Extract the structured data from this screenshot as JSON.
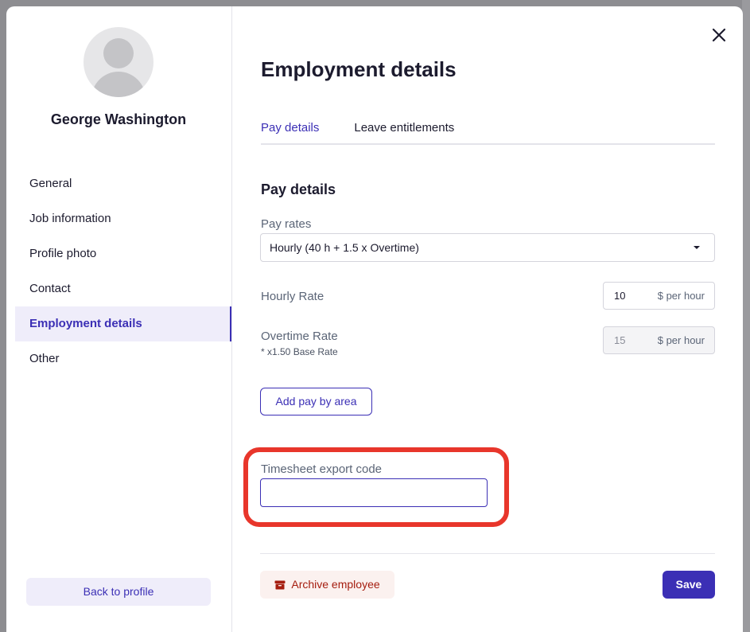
{
  "sidebar": {
    "profile_name": "George Washington",
    "items": [
      {
        "label": "General"
      },
      {
        "label": "Job information"
      },
      {
        "label": "Profile photo"
      },
      {
        "label": "Contact"
      },
      {
        "label": "Employment details",
        "active": true
      },
      {
        "label": "Other"
      }
    ],
    "back_label": "Back to profile"
  },
  "main": {
    "title": "Employment details",
    "tabs": [
      {
        "label": "Pay details",
        "active": true
      },
      {
        "label": "Leave entitlements"
      }
    ],
    "section_title": "Pay details",
    "pay_rates": {
      "label": "Pay rates",
      "selected": "Hourly (40 h + 1.5 x Overtime)"
    },
    "hourly_rate": {
      "label": "Hourly Rate",
      "value": "10",
      "unit": "$ per hour"
    },
    "overtime_rate": {
      "label": "Overtime Rate",
      "note": "*  x1.50 Base Rate",
      "value": "15",
      "unit": "$ per hour"
    },
    "add_pay_label": "Add pay by area",
    "export_code": {
      "label": "Timesheet export code",
      "value": ""
    },
    "archive_label": "Archive employee",
    "save_label": "Save"
  },
  "colors": {
    "accent": "#3b2fb5",
    "highlight": "#e8362b",
    "danger_text": "#a51d0f"
  },
  "icons": [
    "close-icon",
    "avatar-placeholder-icon",
    "caret-down-icon",
    "archive-box-icon"
  ]
}
